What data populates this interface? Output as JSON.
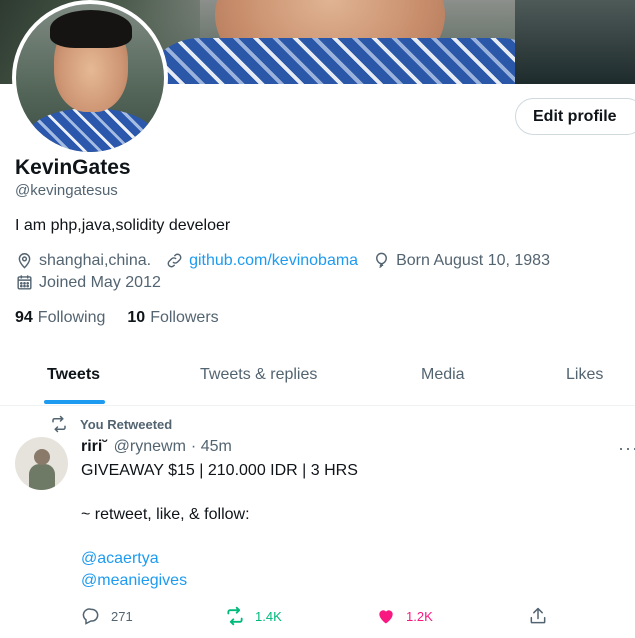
{
  "profile": {
    "name": "KevinGates",
    "handle": "@kevingatesus",
    "bio": "I am php,java,solidity develoer",
    "location": "shanghai,china.",
    "website": "github.com/kevinobama",
    "born": "Born August 10, 1983",
    "joined": "Joined May 2012",
    "following_count": "94",
    "following_label": "Following",
    "followers_count": "10",
    "followers_label": "Followers",
    "edit_button": "Edit profile"
  },
  "tabs": [
    {
      "label": "Tweets",
      "active": true
    },
    {
      "label": "Tweets & replies",
      "active": false
    },
    {
      "label": "Media",
      "active": false
    },
    {
      "label": "Likes",
      "active": false
    }
  ],
  "tweet": {
    "retweet_label": "You Retweeted",
    "display_name": "riri˘",
    "username": "@rynewm",
    "time": "· 45m",
    "more": "···",
    "line1": "GIVEAWAY $15 | 210.000 IDR | 3 HRS",
    "line2": "~ retweet, like, & follow:",
    "mention1": "@acaertya",
    "mention2": "@meaniegives",
    "replies": "271",
    "retweets": "1.4K",
    "likes": "1.2K"
  },
  "colors": {
    "accent": "#1d9bf0",
    "retweet_green": "#00ba7c",
    "like_pink": "#f91880",
    "muted": "#536471"
  }
}
